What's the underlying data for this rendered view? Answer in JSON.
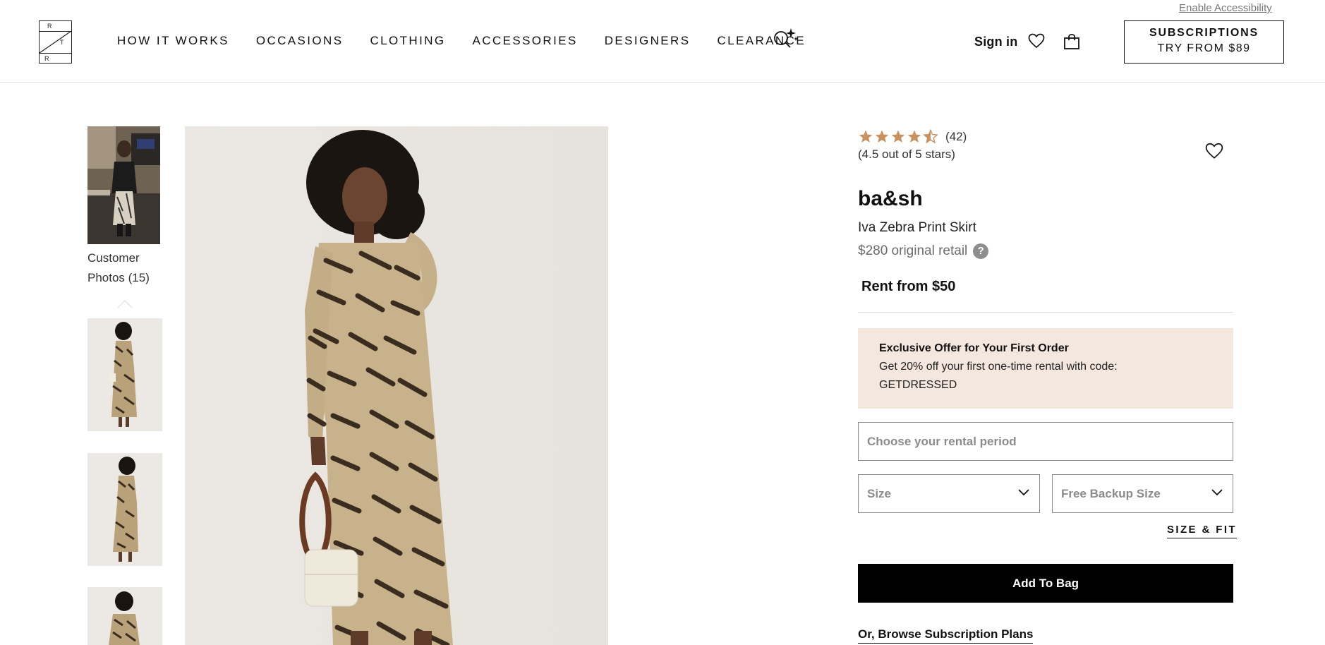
{
  "header": {
    "logo_letters": [
      "R",
      "T",
      "R"
    ],
    "nav": [
      "HOW IT WORKS",
      "OCCASIONS",
      "CLOTHING",
      "ACCESSORIES",
      "DESIGNERS",
      "CLEARANCE"
    ],
    "enable_accessibility": "Enable Accessibility",
    "sign_in": "Sign in",
    "subscriptions_line1": "SUBSCRIPTIONS",
    "subscriptions_line2": "TRY FROM $89",
    "icons": [
      "ai-search-icon",
      "heart-icon",
      "shopping-bag-icon"
    ]
  },
  "gallery": {
    "customer_photos_line1": "Customer",
    "customer_photos_line2": "Photos (15)"
  },
  "product": {
    "rating_count": "(42)",
    "rating_text": "(4.5 out of 5 stars)",
    "rating_value": 4.5,
    "brand": "ba&sh",
    "name": "Iva Zebra Print Skirt",
    "original_retail": "$280 original retail",
    "rent_from": "Rent from $50",
    "offer_title": "Exclusive Offer for Your First Order",
    "offer_desc": "Get 20% off your first one-time rental with code: GETDRESSED",
    "rental_period_placeholder": "Choose your rental period",
    "size_placeholder": "Size",
    "backup_size_placeholder": "Free Backup Size",
    "size_fit": "SIZE & FIT",
    "add_to_bag": "Add To Bag",
    "browse_subscriptions": "Or, Browse Subscription Plans"
  },
  "colors": {
    "star": "#c9915f",
    "offer_bg": "#f3e7de",
    "button_bg": "#000000"
  }
}
